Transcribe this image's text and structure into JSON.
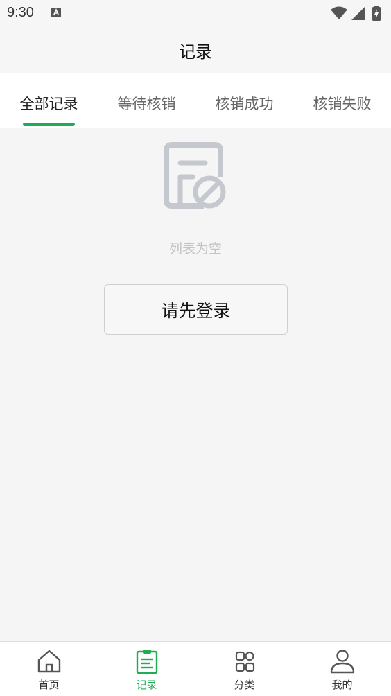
{
  "status_bar": {
    "time": "9:30",
    "icons": [
      "text-a-icon",
      "wifi-icon",
      "signal-icon",
      "battery-charging-icon"
    ]
  },
  "header": {
    "title": "记录"
  },
  "tabs": [
    {
      "label": "全部记录",
      "active": true
    },
    {
      "label": "等待核销",
      "active": false
    },
    {
      "label": "核销成功",
      "active": false
    },
    {
      "label": "核销失败",
      "active": false
    }
  ],
  "empty_state": {
    "icon": "empty-document-icon",
    "text": "列表为空",
    "login_button": "请先登录"
  },
  "bottom_nav": [
    {
      "label": "首页",
      "icon": "home-icon",
      "active": false
    },
    {
      "label": "记录",
      "icon": "clipboard-icon",
      "active": true
    },
    {
      "label": "分类",
      "icon": "grid-icon",
      "active": false
    },
    {
      "label": "我的",
      "icon": "user-icon",
      "active": false
    }
  ],
  "colors": {
    "accent": "#1fac54",
    "background": "#f5f5f5",
    "muted_text": "#c4c4c4",
    "icon_gray": "#c5c8ce"
  }
}
